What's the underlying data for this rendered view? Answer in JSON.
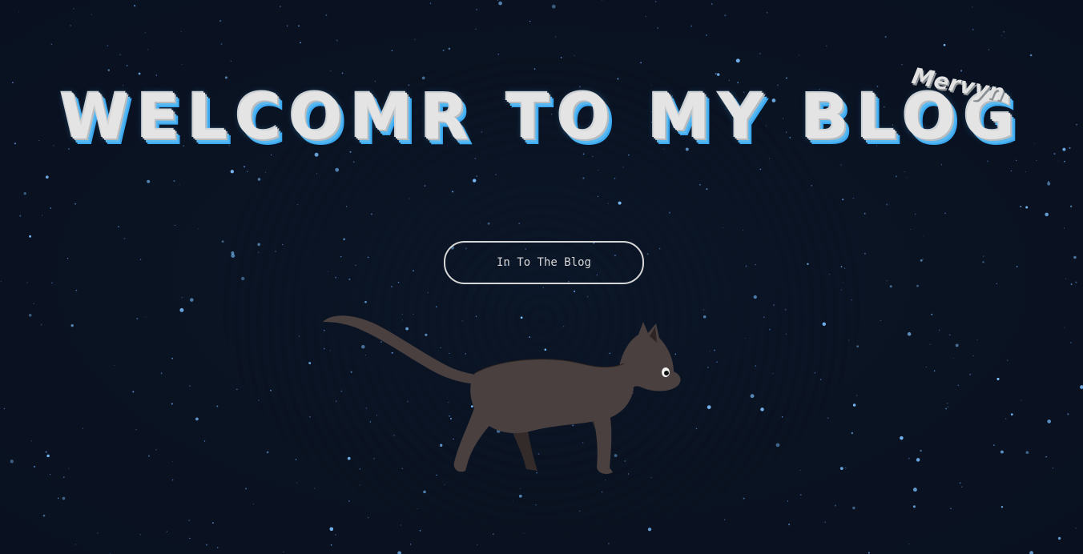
{
  "page": {
    "title": "WELCOMR TO MY BLOG",
    "author": "Mervyn"
  },
  "actions": {
    "enter_label": "In To The Blog"
  },
  "colors": {
    "background": "#0a1322",
    "title_text": "#e4e4e4",
    "title_shadow": "#3ba8ef",
    "star": "#6fb6ff",
    "cat_body": "#4a403f",
    "cat_shade": "#3a3231"
  },
  "icons": {
    "mascot": "walking-cat-illustration"
  }
}
